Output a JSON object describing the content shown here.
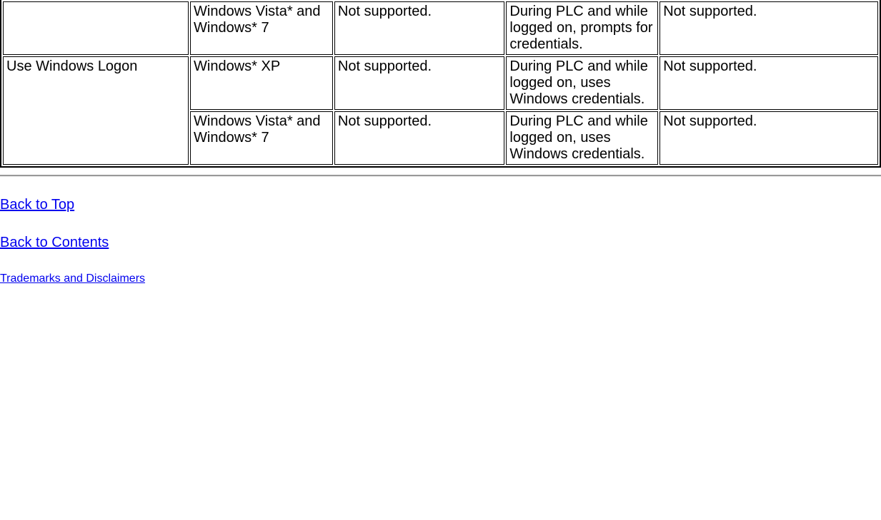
{
  "table": {
    "rows": [
      {
        "c1": "",
        "c2": "Windows Vista* and Windows* 7",
        "c3": "Not supported.",
        "c4": "During PLC and while logged on, prompts for credentials.",
        "c5": "Not supported."
      },
      {
        "c1": "Use Windows Logon",
        "c2": "Windows* XP",
        "c3": "Not supported.",
        "c4": "During PLC and while logged on, uses Windows credentials.",
        "c5": "Not supported."
      },
      {
        "c1": "",
        "c2": "Windows Vista* and Windows* 7",
        "c3": "Not supported.",
        "c4": "During PLC and while logged on, uses Windows credentials.",
        "c5": "Not supported."
      }
    ]
  },
  "links": {
    "back_to_top": "Back to Top",
    "back_to_contents": "Back to Contents",
    "trademarks": "Trademarks and Disclaimers"
  }
}
